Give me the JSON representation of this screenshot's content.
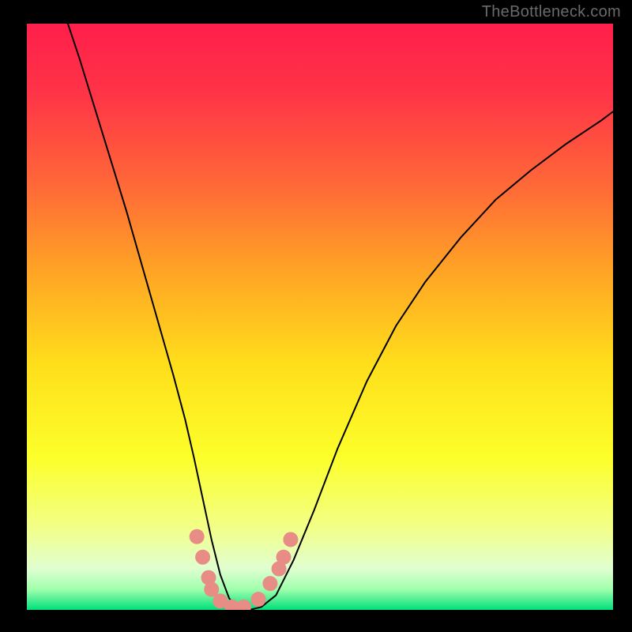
{
  "watermark": "TheBottleneck.com",
  "chart_data": {
    "type": "line",
    "title": "",
    "xlabel": "",
    "ylabel": "",
    "xlim": [
      0,
      100
    ],
    "ylim": [
      0,
      100
    ],
    "grid": false,
    "legend": false,
    "background_gradient_stops": [
      {
        "offset": 0.0,
        "color": "#ff1f4b"
      },
      {
        "offset": 0.12,
        "color": "#ff3447"
      },
      {
        "offset": 0.28,
        "color": "#ff6a37"
      },
      {
        "offset": 0.42,
        "color": "#ffa325"
      },
      {
        "offset": 0.58,
        "color": "#ffde1b"
      },
      {
        "offset": 0.74,
        "color": "#fcff2a"
      },
      {
        "offset": 0.86,
        "color": "#f2ff88"
      },
      {
        "offset": 0.93,
        "color": "#e0ffd1"
      },
      {
        "offset": 0.965,
        "color": "#9fffac"
      },
      {
        "offset": 1.0,
        "color": "#00e07c"
      }
    ],
    "series": [
      {
        "name": "bottleneck-curve",
        "stroke": "#000000",
        "stroke_width": 2,
        "x": [
          7.0,
          9.0,
          11.0,
          13.0,
          15.0,
          17.0,
          19.0,
          21.0,
          23.0,
          25.0,
          27.0,
          28.5,
          30.0,
          31.5,
          33.0,
          34.5,
          36.0,
          38.0,
          40.0,
          42.5,
          45.5,
          49.0,
          53.0,
          58.0,
          63.0,
          68.0,
          74.0,
          80.0,
          86.0,
          92.0,
          98.0,
          100.0
        ],
        "values": [
          100.0,
          94.0,
          87.5,
          81.0,
          74.5,
          68.0,
          61.0,
          54.0,
          47.0,
          40.0,
          32.5,
          26.0,
          19.0,
          12.0,
          6.0,
          2.0,
          0.0,
          0.0,
          0.5,
          2.5,
          8.5,
          17.0,
          27.5,
          39.0,
          48.5,
          56.0,
          63.5,
          70.0,
          75.0,
          79.5,
          83.5,
          85.0
        ]
      }
    ],
    "markers": {
      "name": "highlight-dots",
      "color": "#e88c86",
      "radius_px": 9.5,
      "points": [
        {
          "x": 29.0,
          "y": 12.5
        },
        {
          "x": 30.0,
          "y": 9.0
        },
        {
          "x": 31.0,
          "y": 5.5
        },
        {
          "x": 31.5,
          "y": 3.5
        },
        {
          "x": 33.0,
          "y": 1.5
        },
        {
          "x": 35.0,
          "y": 0.5
        },
        {
          "x": 37.0,
          "y": 0.5
        },
        {
          "x": 39.5,
          "y": 1.8
        },
        {
          "x": 41.5,
          "y": 4.5
        },
        {
          "x": 43.0,
          "y": 7.0
        },
        {
          "x": 43.8,
          "y": 9.0
        },
        {
          "x": 45.0,
          "y": 12.0
        }
      ]
    }
  }
}
